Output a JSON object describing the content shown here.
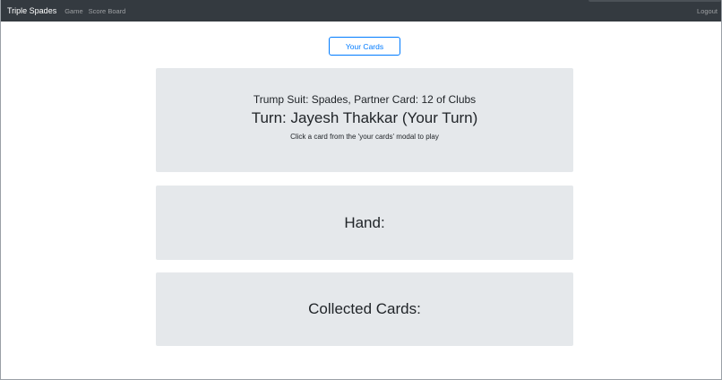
{
  "navbar": {
    "brand": "Triple Spades",
    "links": [
      "Game",
      "Score Board"
    ],
    "logout": "Logout"
  },
  "cards_button": "Your Cards",
  "info": {
    "trump_line": "Trump Suit: Spades, Partner Card: 12 of Clubs",
    "turn_line": "Turn: Jayesh Thakkar (Your Turn)",
    "hint": "Click a card from the 'your cards' modal to play"
  },
  "hand": {
    "heading": "Hand:"
  },
  "collected": {
    "heading": "Collected Cards:"
  },
  "colors": {
    "navbar": "#343a40",
    "panel": "#e5e8eb",
    "accent": "#007bff"
  }
}
